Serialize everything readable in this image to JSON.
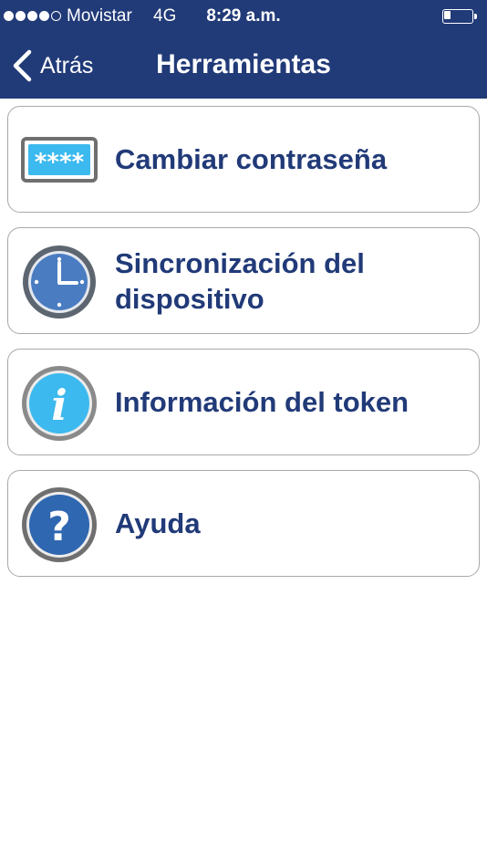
{
  "status_bar": {
    "carrier": "Movistar",
    "network": "4G",
    "time": "8:29 a.m.",
    "signal_bars_filled": 4,
    "signal_bars_total": 5,
    "battery_level": 0.25
  },
  "nav": {
    "back_label": "Atrás",
    "title": "Herramientas"
  },
  "colors": {
    "brand_blue": "#213a78",
    "text_blue": "#213a78",
    "card_border": "#a9a9a9",
    "info_icon_blue": "#3cb9ee"
  },
  "menu": {
    "items": [
      {
        "label": "Cambiar contraseña",
        "icon": "password-field-icon"
      },
      {
        "label": "Sincronización del dispositivo",
        "icon": "clock-icon"
      },
      {
        "label": "Información del token",
        "icon": "info-icon"
      },
      {
        "label": "Ayuda",
        "icon": "help-icon"
      }
    ]
  }
}
